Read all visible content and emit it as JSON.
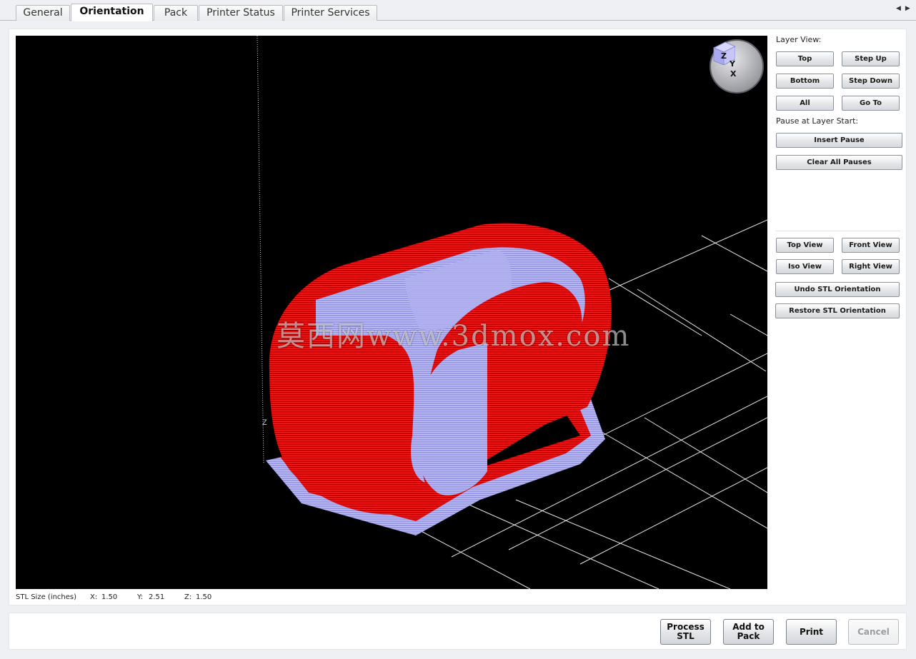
{
  "tabs": [
    {
      "label": "General"
    },
    {
      "label": "Orientation"
    },
    {
      "label": "Pack"
    },
    {
      "label": "Printer Status"
    },
    {
      "label": "Printer Services"
    }
  ],
  "viewport": {
    "watermark": "莫西网www.3dmox.com",
    "z_axis_label": "Z",
    "gizmo_labels": {
      "z": "Z",
      "y": "Y",
      "x": "X"
    },
    "colors": {
      "background": "#000000",
      "outer_shell": "#ff0000",
      "inner_shell": "#a9a9f0",
      "grid": "#ffffff"
    }
  },
  "stl_size": {
    "label": "STL Size (inches)",
    "x_label": "X:",
    "x": "1.50",
    "y_label": "Y:",
    "y": "2.51",
    "z_label": "Z:",
    "z": "1.50"
  },
  "layer_view": {
    "title": "Layer View:",
    "top": "Top",
    "step_up": "Step Up",
    "bottom": "Bottom",
    "step_down": "Step Down",
    "all": "All",
    "go_to": "Go To"
  },
  "pause": {
    "title": "Pause at Layer Start:",
    "insert": "Insert Pause",
    "clear": "Clear All Pauses"
  },
  "views": {
    "top_view": "Top View",
    "front_view": "Front View",
    "iso_view": "Iso View",
    "right_view": "Right View",
    "undo": "Undo STL Orientation",
    "restore": "Restore STL Orientation"
  },
  "actions": {
    "process": "Process\nSTL",
    "add_to_pack": "Add to\nPack",
    "print": "Print",
    "cancel": "Cancel"
  }
}
